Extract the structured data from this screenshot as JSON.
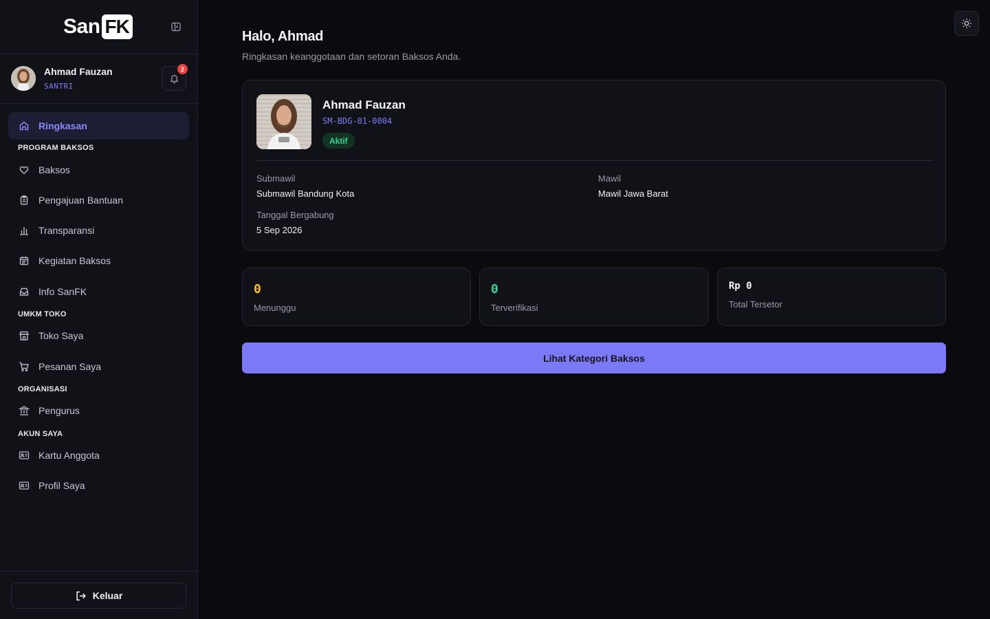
{
  "brand": {
    "logo_left": "San",
    "logo_right": "FK"
  },
  "user": {
    "name": "Ahmad Fauzan",
    "role": "SANTRI",
    "notifications": "2"
  },
  "nav": {
    "ringkasan": "Ringkasan",
    "section_program": "PROGRAM BAKSOS",
    "baksos": "Baksos",
    "pengajuan": "Pengajuan Bantuan",
    "transparansi": "Transparansi",
    "kegiatan": "Kegiatan Baksos",
    "info": "Info SanFK",
    "section_umkm": "UMKM TOKO",
    "toko": "Toko Saya",
    "pesanan": "Pesanan Saya",
    "section_org": "ORGANISASI",
    "pengurus": "Pengurus",
    "section_akun": "AKUN SAYA",
    "kartu": "Kartu Anggota",
    "profil": "Profil Saya"
  },
  "footer": {
    "logout": "Keluar"
  },
  "header": {
    "greeting": "Halo, Ahmad",
    "subtitle": "Ringkasan keanggotaan dan setoran Baksos Anda."
  },
  "profile": {
    "name": "Ahmad Fauzan",
    "member_id": "SM-BDG-01-0004",
    "status": "Aktif",
    "submawil_label": "Submawil",
    "submawil_value": "Submawil Bandung Kota",
    "mawil_label": "Mawil",
    "mawil_value": "Mawil Jawa Barat",
    "joined_label": "Tanggal Bergabung",
    "joined_value": "5 Sep 2026"
  },
  "stats": {
    "waiting_value": "0",
    "waiting_label": "Menunggu",
    "verified_value": "0",
    "verified_label": "Terverifikasi",
    "total_value": "Rp 0",
    "total_label": "Total Tersetor"
  },
  "cta": {
    "label": "Lihat Kategori Baksos"
  },
  "colors": {
    "accent": "#7c79f7",
    "accent_text": "#8b87ff",
    "waiting": "#fbbf24",
    "verified": "#34d399",
    "danger": "#ef4444"
  }
}
